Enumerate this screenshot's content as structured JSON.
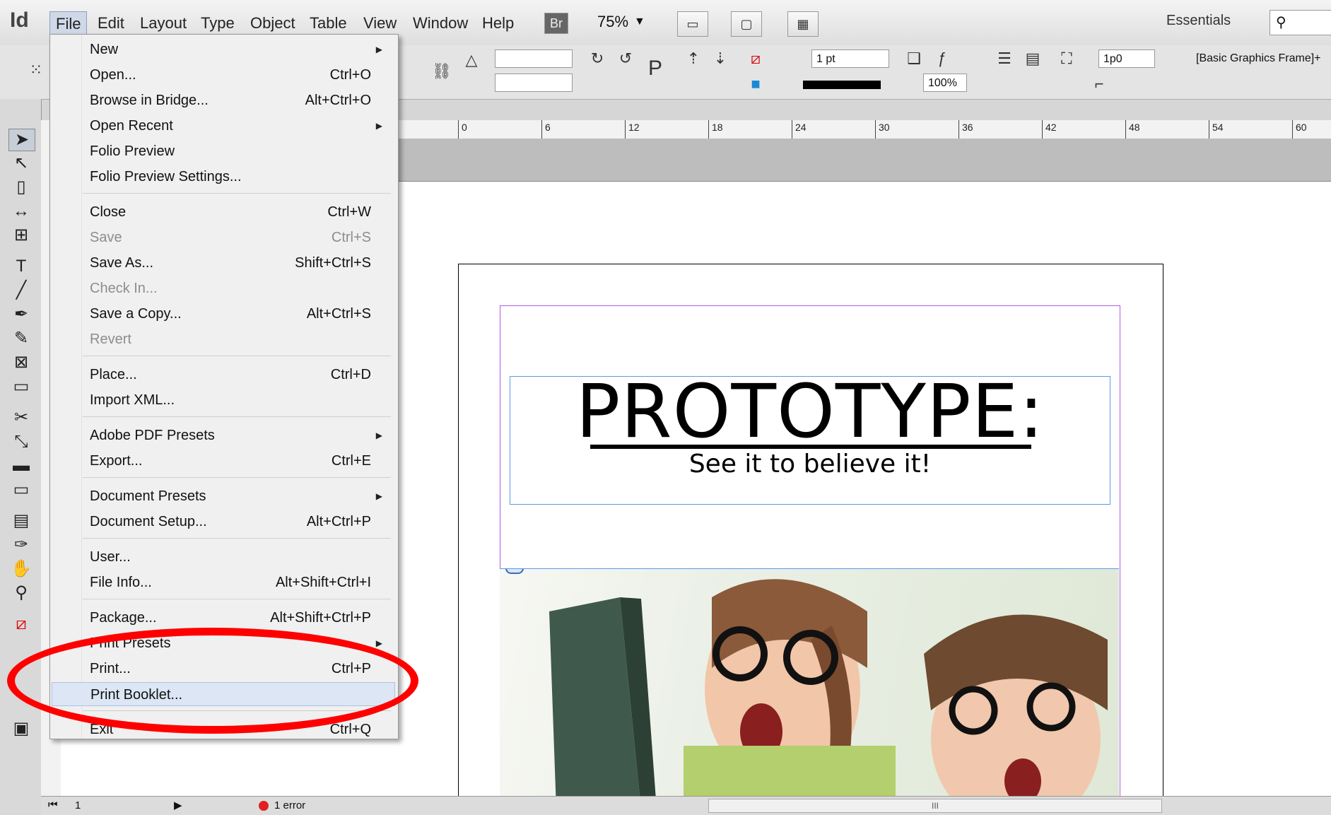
{
  "app": {
    "logo": "Id"
  },
  "menubar": {
    "items": [
      "File",
      "Edit",
      "Layout",
      "Type",
      "Object",
      "Table",
      "View",
      "Window",
      "Help"
    ],
    "bridge_button": "Br",
    "zoom": "75%",
    "workspace": "Essentials"
  },
  "control_panel": {
    "stroke_weight": "1 pt",
    "opacity": "100%",
    "offset": "1p0",
    "object_style": "[Basic Graphics Frame]+"
  },
  "ruler": {
    "labels": [
      "0",
      "6",
      "12",
      "18",
      "24",
      "30",
      "36",
      "42",
      "48",
      "54",
      "60"
    ]
  },
  "document": {
    "headline": "PROTOTYPE:",
    "subheadline": "See it to believe it!"
  },
  "statusbar": {
    "page": "1",
    "preflight": "1 error",
    "scroll_label": "III"
  },
  "file_menu": {
    "items": [
      {
        "label": "New",
        "shortcut": "",
        "submenu": true,
        "disabled": false
      },
      {
        "label": "Open...",
        "shortcut": "Ctrl+O",
        "submenu": false,
        "disabled": false
      },
      {
        "label": "Browse in Bridge...",
        "shortcut": "Alt+Ctrl+O",
        "submenu": false,
        "disabled": false
      },
      {
        "label": "Open Recent",
        "shortcut": "",
        "submenu": true,
        "disabled": false
      },
      {
        "label": "Folio Preview",
        "shortcut": "",
        "submenu": false,
        "disabled": false
      },
      {
        "label": "Folio Preview Settings...",
        "shortcut": "",
        "submenu": false,
        "disabled": false
      },
      {
        "label": "Close",
        "shortcut": "Ctrl+W",
        "submenu": false,
        "disabled": false
      },
      {
        "label": "Save",
        "shortcut": "Ctrl+S",
        "submenu": false,
        "disabled": true
      },
      {
        "label": "Save As...",
        "shortcut": "Shift+Ctrl+S",
        "submenu": false,
        "disabled": false
      },
      {
        "label": "Check In...",
        "shortcut": "",
        "submenu": false,
        "disabled": true
      },
      {
        "label": "Save a Copy...",
        "shortcut": "Alt+Ctrl+S",
        "submenu": false,
        "disabled": false
      },
      {
        "label": "Revert",
        "shortcut": "",
        "submenu": false,
        "disabled": true
      },
      {
        "label": "Place...",
        "shortcut": "Ctrl+D",
        "submenu": false,
        "disabled": false
      },
      {
        "label": "Import XML...",
        "shortcut": "",
        "submenu": false,
        "disabled": false
      },
      {
        "label": "Adobe PDF Presets",
        "shortcut": "",
        "submenu": true,
        "disabled": false
      },
      {
        "label": "Export...",
        "shortcut": "Ctrl+E",
        "submenu": false,
        "disabled": false
      },
      {
        "label": "Document Presets",
        "shortcut": "",
        "submenu": true,
        "disabled": false
      },
      {
        "label": "Document Setup...",
        "shortcut": "Alt+Ctrl+P",
        "submenu": false,
        "disabled": false
      },
      {
        "label": "User...",
        "shortcut": "",
        "submenu": false,
        "disabled": false
      },
      {
        "label": "File Info...",
        "shortcut": "Alt+Shift+Ctrl+I",
        "submenu": false,
        "disabled": false
      },
      {
        "label": "Package...",
        "shortcut": "Alt+Shift+Ctrl+P",
        "submenu": false,
        "disabled": false
      },
      {
        "label": "Print Presets",
        "shortcut": "",
        "submenu": true,
        "disabled": false
      },
      {
        "label": "Print...",
        "shortcut": "Ctrl+P",
        "submenu": false,
        "disabled": false
      },
      {
        "label": "Print Booklet...",
        "shortcut": "",
        "submenu": false,
        "disabled": false,
        "highlighted": true
      },
      {
        "label": "Exit",
        "shortcut": "Ctrl+Q",
        "submenu": false,
        "disabled": false
      }
    ]
  },
  "colors": {
    "annotation": "#ff0000",
    "margin_guide": "#b05ce8",
    "frame_edge": "#5b9be6",
    "preflight_error": "#e02020"
  }
}
